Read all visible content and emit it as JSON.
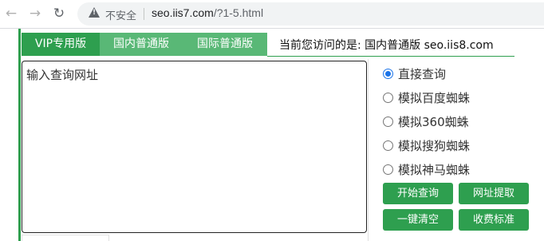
{
  "browser": {
    "back_icon": "arrow-left-icon",
    "forward_icon": "arrow-right-icon",
    "reload_icon": "reload-icon",
    "security_label": "不安全",
    "url_host": "seo.iis7.com",
    "url_path": "/?1-5.html"
  },
  "tabs": [
    {
      "label": "VIP专用版",
      "active": true
    },
    {
      "label": "国内普通版",
      "active": false
    },
    {
      "label": "国际普通版",
      "active": false
    }
  ],
  "notice": "当前您访问的是: 国内普通版 seo.iis8.com",
  "textarea": {
    "placeholder": "输入查询网址"
  },
  "options": [
    {
      "label": "直接查询",
      "checked": true
    },
    {
      "label": "模拟百度蜘蛛",
      "checked": false
    },
    {
      "label": "模拟360蜘蛛",
      "checked": false
    },
    {
      "label": "模拟搜狗蜘蛛",
      "checked": false
    },
    {
      "label": "模拟神马蜘蛛",
      "checked": false
    }
  ],
  "buttons": {
    "start": "开始查询",
    "extract": "网址提取",
    "clear": "一键清空",
    "pricing": "收费标准"
  },
  "colors": {
    "accent": "#2e9f4f",
    "tab_normal": "#59b876"
  }
}
